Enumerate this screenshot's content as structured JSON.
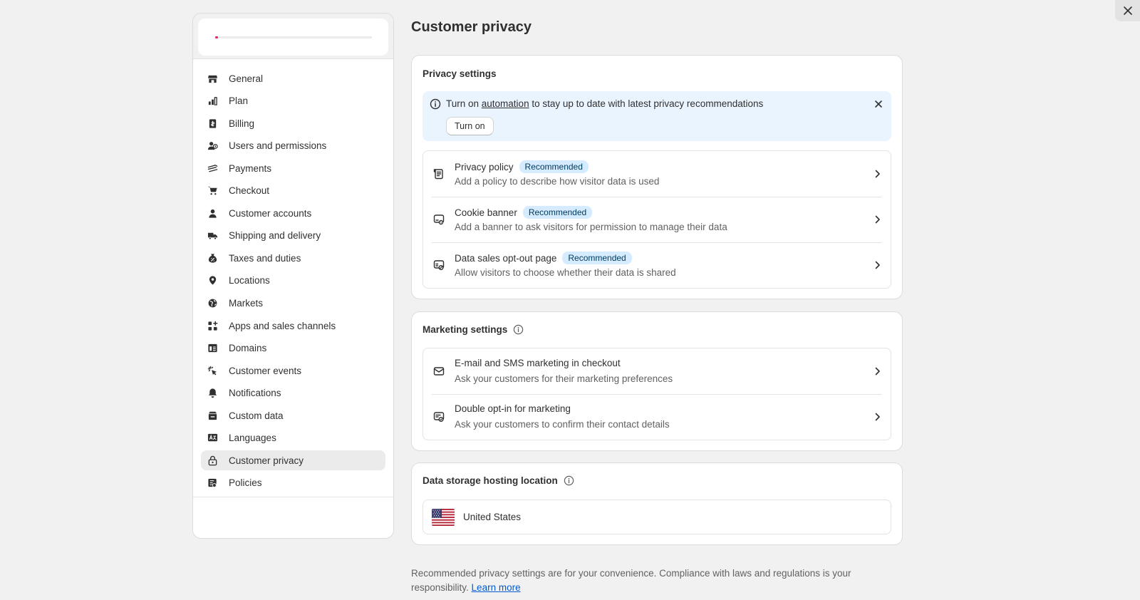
{
  "sidebar": {
    "store_setup_progress": 0.02,
    "items": [
      {
        "label": "General",
        "icon": "store-icon"
      },
      {
        "label": "Plan",
        "icon": "plan-icon"
      },
      {
        "label": "Billing",
        "icon": "billing-icon"
      },
      {
        "label": "Users and permissions",
        "icon": "users-icon"
      },
      {
        "label": "Payments",
        "icon": "payments-icon"
      },
      {
        "label": "Checkout",
        "icon": "cart-icon"
      },
      {
        "label": "Customer accounts",
        "icon": "person-icon"
      },
      {
        "label": "Shipping and delivery",
        "icon": "truck-icon"
      },
      {
        "label": "Taxes and duties",
        "icon": "tax-icon"
      },
      {
        "label": "Locations",
        "icon": "location-pin-icon"
      },
      {
        "label": "Markets",
        "icon": "globe-icon"
      },
      {
        "label": "Apps and sales channels",
        "icon": "apps-icon"
      },
      {
        "label": "Domains",
        "icon": "domain-icon"
      },
      {
        "label": "Customer events",
        "icon": "cursor-click-icon"
      },
      {
        "label": "Notifications",
        "icon": "bell-icon"
      },
      {
        "label": "Custom data",
        "icon": "database-icon"
      },
      {
        "label": "Languages",
        "icon": "language-icon"
      },
      {
        "label": "Customer privacy",
        "icon": "lock-icon",
        "active": true
      },
      {
        "label": "Policies",
        "icon": "policy-icon"
      }
    ]
  },
  "main": {
    "title": "Customer privacy",
    "privacy": {
      "title": "Privacy settings",
      "banner": {
        "text_before": "Turn on ",
        "link": "automation",
        "text_after": " to stay up to date with latest privacy recommendations",
        "button": "Turn on"
      },
      "rows": [
        {
          "title": "Privacy policy",
          "badge": "Recommended",
          "desc": "Add a policy to describe how visitor data is used",
          "icon": "policy-doc-icon"
        },
        {
          "title": "Cookie banner",
          "badge": "Recommended",
          "desc": "Add a banner to ask visitors for permission to manage their data",
          "icon": "cookie-banner-icon"
        },
        {
          "title": "Data sales opt-out page",
          "badge": "Recommended",
          "desc": "Allow visitors to choose whether their data is shared",
          "icon": "opt-out-icon"
        }
      ]
    },
    "marketing": {
      "title": "Marketing settings",
      "rows": [
        {
          "title": "E-mail and SMS marketing in checkout",
          "desc": "Ask your customers for their marketing preferences",
          "icon": "email-icon"
        },
        {
          "title": "Double opt-in for marketing",
          "desc": "Ask your customers to confirm their contact details",
          "icon": "double-opt-in-icon"
        }
      ]
    },
    "storage": {
      "title": "Data storage hosting location",
      "location": "United States",
      "flag": "us-flag-icon"
    },
    "footnote": {
      "text": "Recommended privacy settings are for your convenience. Compliance with laws and regulations is your responsibility. ",
      "link": "Learn more"
    }
  },
  "colors": {
    "badge_bg": "#d5ebff",
    "banner_bg": "#eaf4ff",
    "link": "#005bd3",
    "progress": "#e0245e"
  }
}
